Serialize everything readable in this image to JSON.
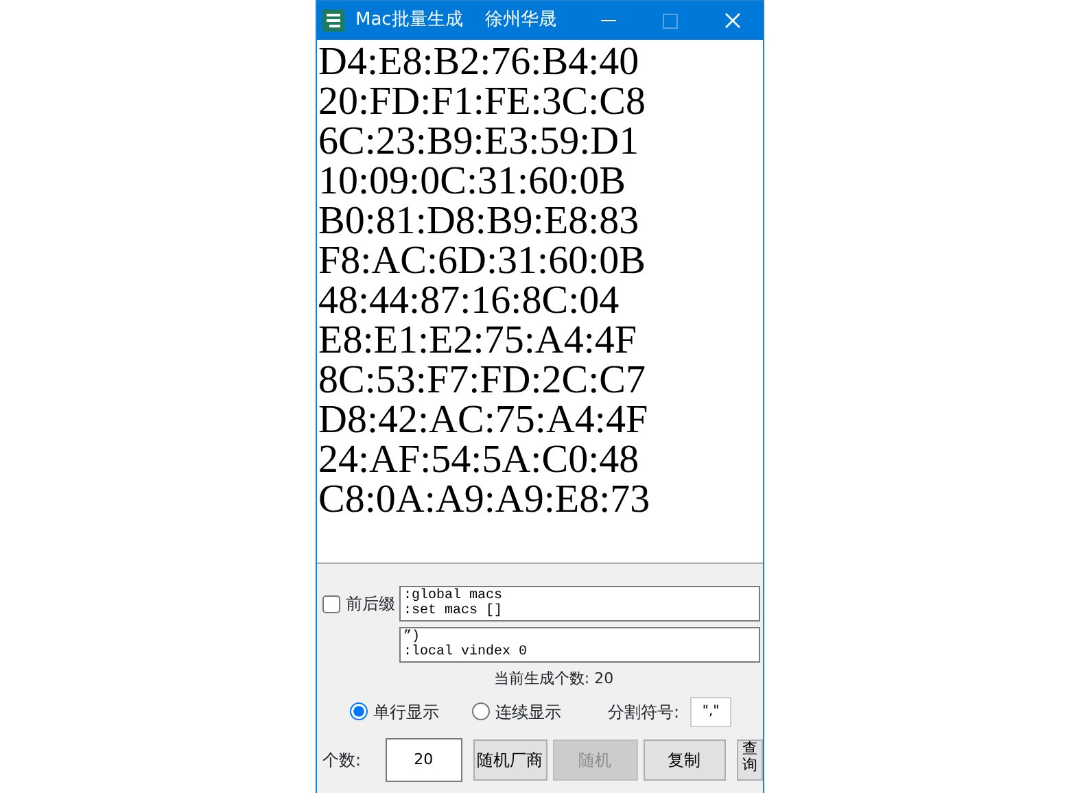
{
  "window": {
    "title": "Mac批量生成",
    "subtitle": "徐州华晟"
  },
  "output_lines": [
    "D4:E8:B2:76:B4:40",
    "20:FD:F1:FE:3C:C8",
    "6C:23:B9:E3:59:D1",
    "10:09:0C:31:60:0B",
    "B0:81:D8:B9:E8:83",
    "F8:AC:6D:31:60:0B",
    "48:44:87:16:8C:04",
    "E8:E1:E2:75:A4:4F",
    "8C:53:F7:FD:2C:C7",
    "D8:42:AC:75:A4:4F",
    "24:AF:54:5A:C0:48",
    "C8:0A:A9:A9:E8:73"
  ],
  "affix": {
    "label": "前后缀",
    "checked": false,
    "prefix": ":global macs\n:set macs []",
    "suffix": "”)\n:local vindex 0"
  },
  "count_status": "当前生成个数: 20",
  "display_modes": [
    {
      "label": "单行显示",
      "selected": true
    },
    {
      "label": "连续显示",
      "selected": false
    }
  ],
  "separator": {
    "label": "分割符号:",
    "value": "\",\""
  },
  "count": {
    "label": "个数:",
    "value": "20"
  },
  "buttons": [
    {
      "label": "随机厂商",
      "disabled": false
    },
    {
      "label": "随机",
      "disabled": true
    },
    {
      "label": "复制",
      "disabled": false
    }
  ],
  "query_button": "查询"
}
